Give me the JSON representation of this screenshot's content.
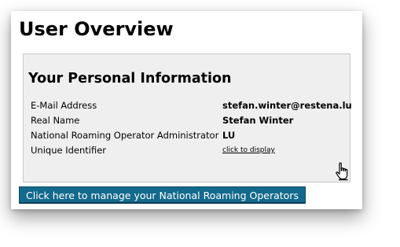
{
  "page": {
    "title": "User Overview"
  },
  "personal_info": {
    "heading": "Your Personal Information",
    "rows": [
      {
        "label": "E-Mail Address",
        "value": "stefan.winter@restena.lu"
      },
      {
        "label": "Real Name",
        "value": "Stefan Winter"
      },
      {
        "label": "National Roaming Operator Administrator",
        "value": "LU"
      },
      {
        "label": "Unique Identifier",
        "link_text": "click to display"
      }
    ]
  },
  "actions": {
    "manage_label": "Click here to manage your National Roaming Operators"
  },
  "icons": {
    "cursor": "hand-pointer-icon"
  },
  "colors": {
    "button_background": "#146a8c",
    "button_text": "#ffffff",
    "panel_background": "#efefef"
  }
}
